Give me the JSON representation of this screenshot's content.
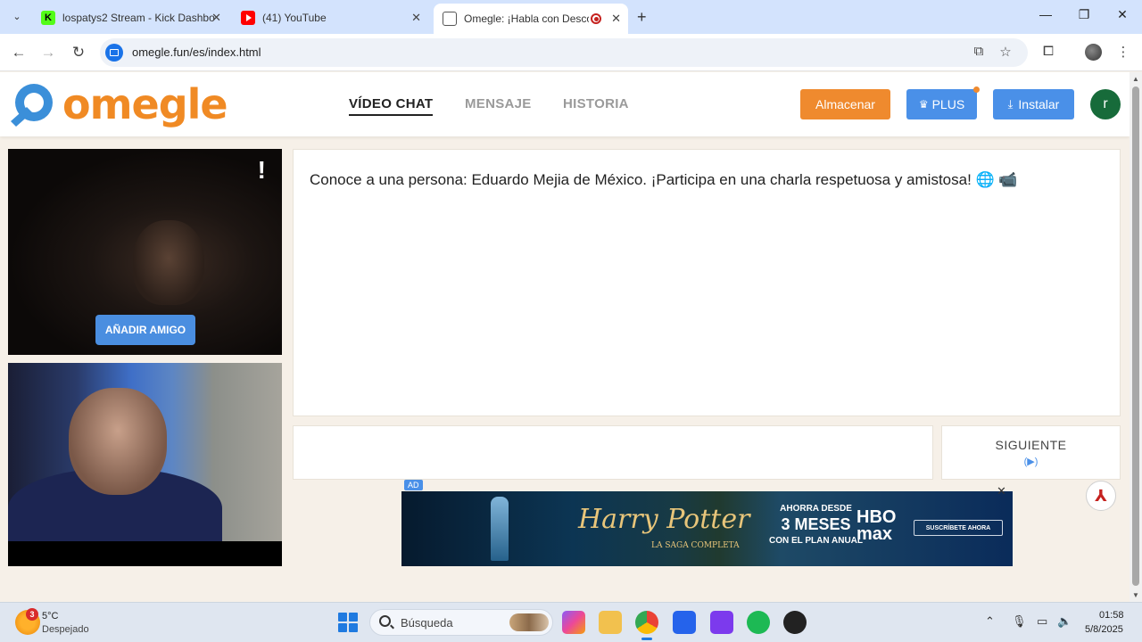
{
  "browser": {
    "tabs": [
      {
        "title": "lospatys2 Stream - Kick Dashbo",
        "favicon": "kick-icon"
      },
      {
        "title": "(41) YouTube",
        "favicon": "youtube-icon"
      },
      {
        "title": "Omegle: ¡Habla con Descon",
        "favicon": "globe-icon",
        "active": true,
        "recording": true
      }
    ],
    "new_tab": "+",
    "url": "omegle.fun/es/index.html"
  },
  "site": {
    "logo_text": "omegle",
    "nav": [
      {
        "label": "VÍDEO CHAT",
        "active": true
      },
      {
        "label": "MENSAJE",
        "active": false
      },
      {
        "label": "HISTORIA",
        "active": false
      }
    ],
    "store_label": "Almacenar",
    "plus_label": "PLUS",
    "install_label": "Instalar",
    "user_initial": "r"
  },
  "video": {
    "alert_glyph": "!",
    "add_friend_label": "AÑADIR AMIGO"
  },
  "chat": {
    "message": "Conoce a una persona: Eduardo Mejia de México. ¡Participa en una charla respetuosa y amistosa! 🌐 📹",
    "input_value": "",
    "next_label": "SIGUIENTE",
    "next_icon": "(▶)"
  },
  "ad": {
    "badge": "AD",
    "title": "Harry Potter",
    "subtitle": "LA SAGA COMPLETA",
    "offer_line1": "AHORRA DESDE",
    "offer_line2": "3 MESES",
    "offer_line3": "CON EL PLAN ANUAL",
    "brand_line1": "HBO",
    "brand_line2": "max",
    "cta": "SUSCRÍBETE AHORA",
    "close": "✕"
  },
  "taskbar": {
    "weather_badge": "3",
    "weather_temp": "5°C",
    "weather_desc": "Despejado",
    "search_placeholder": "Búsqueda",
    "time": "01:58",
    "date": "5/8/2025"
  },
  "colors": {
    "accent_orange": "#ef8a2e",
    "accent_blue": "#4a90e8",
    "avatar_green": "#176b3a"
  }
}
